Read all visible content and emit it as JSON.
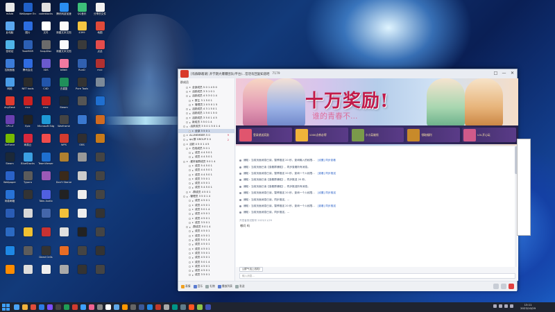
{
  "desktop": {
    "icons": [
      {
        "label": "mAdd",
        "color": "#e8e8e8"
      },
      {
        "label": "Wallpaper Engine",
        "color": "#2060c8"
      },
      {
        "label": "codeblocks",
        "color": "#e0e0e0"
      },
      {
        "label": "腾讯网游加速",
        "color": "#2a8df0"
      },
      {
        "label": "QQ音乐",
        "color": "#3dbf7a"
      },
      {
        "label": "分享的文件",
        "color": "#f2f2f2"
      },
      {
        "label": "此电脑",
        "color": "#5aa7f0"
      },
      {
        "label": "图片",
        "color": "#2c6de0"
      },
      {
        "label": "文件",
        "color": "#ffffff"
      },
      {
        "label": "新建文本文档",
        "color": "#fafafa"
      },
      {
        "label": "4399",
        "color": "#f5c542"
      },
      {
        "label": "地图",
        "color": "#e04a3a"
      },
      {
        "label": "回收站",
        "color": "#4fb4e8"
      },
      {
        "label": "TaskMGR",
        "color": "#2c5fb4"
      },
      {
        "label": "SnapDisc",
        "color": "#6b6b6b"
      },
      {
        "label": "新建文本文档",
        "color": "#fafafa"
      },
      {
        "label": "",
        "color": "#3a3a3a"
      },
      {
        "label": "点此",
        "color": "#e44c4c"
      },
      {
        "label": "控制面板",
        "color": "#3b7bd8"
      },
      {
        "label": "腾讯会议",
        "color": "#2f6be0"
      },
      {
        "label": "3DS",
        "color": "#6a5acd"
      },
      {
        "label": "bilibili",
        "color": "#f07aa0"
      },
      {
        "label": "RunD",
        "color": "#3060b0"
      },
      {
        "label": "mcc",
        "color": "#b03030"
      },
      {
        "label": "网络",
        "color": "#4a9de8"
      },
      {
        "label": "NET tools",
        "color": "#2b2b2b"
      },
      {
        "label": "C4D",
        "color": "#2255aa"
      },
      {
        "label": "去重复",
        "color": "#1f8f5a"
      },
      {
        "label": "Pure Tools",
        "color": "#333333"
      },
      {
        "label": "",
        "color": "#7c8a99"
      },
      {
        "label": "AnyDesk",
        "color": "#e03a2f"
      },
      {
        "label": "mcc",
        "color": "#c22"
      },
      {
        "label": "mcc",
        "color": "#c22"
      },
      {
        "label": "Steam",
        "color": "#1b2838"
      },
      {
        "label": "",
        "color": "#555"
      },
      {
        "label": "",
        "color": "#1f6fd0"
      },
      {
        "label": "CPU-Z",
        "color": "#6a3fb0"
      },
      {
        "label": "Epic",
        "color": "#222"
      },
      {
        "label": "Microsoft Edge",
        "color": "#1e9ad6"
      },
      {
        "label": "Warframe",
        "color": "#444"
      },
      {
        "label": "",
        "color": "#3a78d0"
      },
      {
        "label": "",
        "color": "#d06a20"
      },
      {
        "label": "GeForce",
        "color": "#76b900"
      },
      {
        "label": "网易云",
        "color": "#d8283c"
      },
      {
        "label": "",
        "color": "#ef4c4c"
      },
      {
        "label": "WPS",
        "color": "#d23b2f"
      },
      {
        "label": "OBS",
        "color": "#302e31"
      },
      {
        "label": "",
        "color": "#c77a1a"
      },
      {
        "label": "Steam",
        "color": "#1b2838"
      },
      {
        "label": "BlueStacks",
        "color": "#3b9fe2"
      },
      {
        "label": "TeamViewer",
        "color": "#1e6fd0"
      },
      {
        "label": "",
        "color": "#b08030"
      },
      {
        "label": "",
        "color": "#999"
      },
      {
        "label": "",
        "color": "#444"
      },
      {
        "label": "Wallpaper",
        "color": "#2a62c8"
      },
      {
        "label": "Typora",
        "color": "#5b5b5b"
      },
      {
        "label": "",
        "color": "#9b59b6"
      },
      {
        "label": "Don't Starve",
        "color": "#3a2a1a"
      },
      {
        "label": "",
        "color": "#ccc"
      },
      {
        "label": "",
        "color": "#444"
      },
      {
        "label": "网易邮箱",
        "color": "#2872d6"
      },
      {
        "label": "",
        "color": "#333"
      },
      {
        "label": "Tabs Audio",
        "color": "#5060e0"
      },
      {
        "label": "",
        "color": "#222"
      },
      {
        "label": "",
        "color": "#eee"
      },
      {
        "label": "",
        "color": "#444"
      },
      {
        "label": "",
        "color": "#2a5cb5"
      },
      {
        "label": "",
        "color": "#d8d8d8"
      },
      {
        "label": "",
        "color": "#4466aa"
      },
      {
        "label": "",
        "color": "#f2c13a"
      },
      {
        "label": "",
        "color": "#eee"
      },
      {
        "label": "",
        "color": "#333"
      },
      {
        "label": "",
        "color": "#2b6ac2"
      },
      {
        "label": "",
        "color": "#f0c030"
      },
      {
        "label": "",
        "color": "#c83232"
      },
      {
        "label": "",
        "color": "#e0e0e0"
      },
      {
        "label": "",
        "color": "#222"
      },
      {
        "label": "",
        "color": "#444"
      },
      {
        "label": "",
        "color": "#1e88e5"
      },
      {
        "label": "",
        "color": "#5c5c5c"
      },
      {
        "label": "Dead Cells",
        "color": "#333"
      },
      {
        "label": "",
        "color": "#e86c24"
      },
      {
        "label": "",
        "color": "#444"
      },
      {
        "label": "",
        "color": "#333"
      },
      {
        "label": "",
        "color": "#ff8c00"
      },
      {
        "label": "",
        "color": "#ddd"
      },
      {
        "label": "",
        "color": "#eee"
      },
      {
        "label": "",
        "color": "#aaa"
      },
      {
        "label": "",
        "color": "#333"
      },
      {
        "label": "",
        "color": "#444"
      }
    ]
  },
  "window": {
    "title": "[有群聊邀请]  开学期大爆爆团队(平台)...官话有回复知道吧",
    "count": "7179",
    "buttons": [
      "□",
      "—",
      "✕"
    ]
  },
  "sidebar": {
    "header": "群成员",
    "rows": [
      {
        "label": "全部成员 5 0 1 4 5 0",
        "indent": 2,
        "badge": ""
      },
      {
        "label": "活跃成员 3 5 1 0 1",
        "indent": 2,
        "badge": ""
      },
      {
        "label": "活跃成员 4 5 3 0 1 4",
        "indent": 2,
        "badge": ""
      },
      {
        "label": "群主 3 1 5 0 1",
        "indent": 3,
        "badge": ""
      },
      {
        "label": "管理员 2 0 5 0 1 5",
        "indent": 3,
        "badge": ""
      },
      {
        "label": "活跃成员 4 3 1 5 0 1",
        "indent": 2,
        "badge": ""
      },
      {
        "label": "活跃成员 1 5 0 1 5 0",
        "indent": 2,
        "badge": ""
      },
      {
        "label": "活跃成员 3 5 0 1 4 5",
        "indent": 2,
        "badge": ""
      },
      {
        "label": "新成员 3 5 0 1 4",
        "indent": 2,
        "badge": ""
      },
      {
        "label": "-活跃成员 3 5 0 1 5 0 1 4",
        "indent": 1,
        "badge": ""
      },
      {
        "label": "全部 3 5 0 1",
        "indent": 3,
        "badge": "",
        "sel": true
      },
      {
        "label": "ALLMEMBER 5 0",
        "indent": 1,
        "badge": "9"
      },
      {
        "label": "qq 群 GROUP 5 0",
        "indent": 1,
        "badge": "2"
      },
      {
        "label": "活跃 4 5 0 1 4 5",
        "indent": 1,
        "badge": ""
      },
      {
        "label": "在线成员 5 0 1",
        "indent": 2,
        "badge": ""
      },
      {
        "label": "成员 4 4 5 0 1",
        "indent": 3,
        "badge": ""
      },
      {
        "label": "成员 4 4 5 0 1",
        "indent": 3,
        "badge": ""
      },
      {
        "label": "-爱好者群成员 5 0 1 4",
        "indent": 1,
        "badge": ""
      },
      {
        "label": "成员 5 4 5 0 1",
        "indent": 3,
        "badge": ""
      },
      {
        "label": "成员 4 4 5 0 1",
        "indent": 3,
        "badge": ""
      },
      {
        "label": "成员 4 4 5 0 1",
        "indent": 3,
        "badge": ""
      },
      {
        "label": "成员 3 5 0 1",
        "indent": 3,
        "badge": ""
      },
      {
        "label": "成员 4 5 0 1",
        "indent": 3,
        "badge": ""
      },
      {
        "label": "成员 5 4 5 0 1",
        "indent": 3,
        "badge": ""
      },
      {
        "label": "-群成员 4 5 0 1",
        "indent": 2,
        "badge": ""
      },
      {
        "label": "-管理员 3 5 0 1 4",
        "indent": 1,
        "badge": ""
      },
      {
        "label": "成员 4 5 0 1",
        "indent": 3,
        "badge": ""
      },
      {
        "label": "成员 4 5 0 1",
        "indent": 3,
        "badge": ""
      },
      {
        "label": "成员 5 0 1 4",
        "indent": 3,
        "badge": ""
      },
      {
        "label": "成员 4 5 0 1",
        "indent": 3,
        "badge": ""
      },
      {
        "label": "成员 4 5 0 1",
        "indent": 3,
        "badge": ""
      },
      {
        "label": "成员 3 5 0 1",
        "indent": 3,
        "badge": ""
      },
      {
        "label": "-群成员 5 0 1 4",
        "indent": 2,
        "badge": ""
      },
      {
        "label": "成员 4 5 0 1",
        "indent": 3,
        "badge": ""
      },
      {
        "label": "成员 4 5 0 1",
        "indent": 3,
        "badge": ""
      },
      {
        "label": "成员 5 0 1 4",
        "indent": 3,
        "badge": ""
      },
      {
        "label": "成员 4 5 0 1",
        "indent": 3,
        "badge": ""
      },
      {
        "label": "成员 4 5 0 1",
        "indent": 3,
        "badge": ""
      },
      {
        "label": "成员 3 5 0 1",
        "indent": 3,
        "badge": ""
      },
      {
        "label": "成员 4 5 0 1",
        "indent": 3,
        "badge": ""
      },
      {
        "label": "成员 5 0 1 4",
        "indent": 3,
        "badge": ""
      },
      {
        "label": "成员 4 5 0 1",
        "indent": 3,
        "badge": ""
      },
      {
        "label": "成员 4 5 0 1",
        "indent": 3,
        "badge": ""
      },
      {
        "label": "成员 3 5 0 1",
        "indent": 3,
        "badge": ""
      }
    ]
  },
  "banner": {
    "headline": "十万奖励!",
    "sub": "谁的青春不...",
    "cards": [
      "登录就送奖励",
      "1000点券必得",
      "小小英雄领",
      "领取福利",
      "LOL开心玩"
    ]
  },
  "chat": {
    "messages": [
      {
        "text": "通知：当前页面消息已读，暂停推送 20 秒，查询输入的权限...",
        "link": "[设置] 同步查看"
      },
      {
        "text": "通知：当前页面已读【查看群通知】，同步查看所有消息。",
        "link": ""
      },
      {
        "text": "通知：当前页面消息已读，暂停推送 20 秒，查询一个人权限...",
        "link": "[查看] 同步推送"
      },
      {
        "text": "通知：当前页面已读【查看群通知】，同步推送 20 秒。",
        "link": ""
      },
      {
        "text": "通知：当前页面已读【查看群通知】，同步推送所有消息。",
        "link": ""
      },
      {
        "text": "通知：当前页面消息已读，暂停推送 20 秒，查询一个人权限...",
        "link": "[设置] 同步推送"
      },
      {
        "text": "通知：当前页面消息已读，同步推送，...",
        "link": ""
      },
      {
        "text": "通知：当前页面消息已读，暂停推送 20 秒，查询一个人权限...",
        "link": "[查看] 同步推送"
      },
      {
        "text": "通知：当前页面消息已读，同步推送，...",
        "link": ""
      }
    ],
    "sender": "开发者测试账号 2023/11/29",
    "reply": "哪问 吗"
  },
  "input": {
    "quote": "公屏气泡上线啦!",
    "placeholder": "输入消息..."
  },
  "bottombar": {
    "items": [
      "表情",
      "音乐",
      "礼物",
      "播放列表",
      "发送",
      "分享"
    ]
  },
  "taskbar": {
    "time": "13:11",
    "date": "2023/10/29",
    "apps": [
      "#4aa3f5",
      "#f3b33d",
      "#e24d3b",
      "#2c7be5",
      "#7c4dff",
      "#444",
      "#1f9d55",
      "#d23b2f",
      "#3ea0ff",
      "#f06292",
      "#888",
      "#ffffff",
      "#5fa8e8",
      "#ff9800",
      "#666",
      "#3b5998",
      "#1e88e5",
      "#c0392b",
      "#aaa",
      "#009688",
      "#607d8b",
      "#ff5722",
      "#8bc34a",
      "#3f51b5"
    ]
  }
}
